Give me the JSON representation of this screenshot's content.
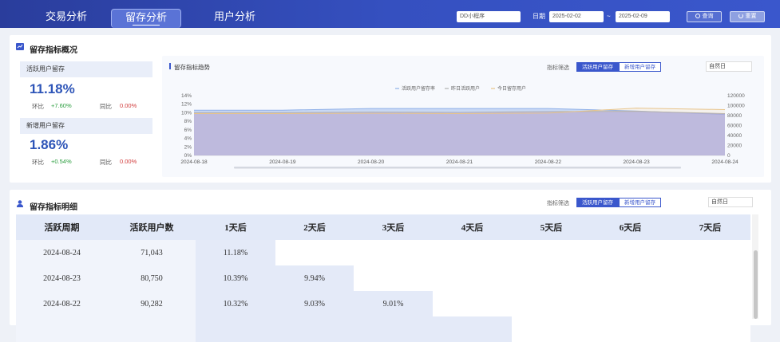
{
  "nav": {
    "tabs": [
      {
        "label": "交易分析"
      },
      {
        "label": "留存分析"
      },
      {
        "label": "用户分析"
      }
    ]
  },
  "filters": {
    "app": "DD小程序",
    "date_label": "日期",
    "start_date": "2025-02-02",
    "separator": "~",
    "end_date": "2025-02-09",
    "query_label": "查询",
    "reset_label": "重置"
  },
  "overview": {
    "title": "留存指标概况",
    "active": {
      "label": "活跃用户留存",
      "value": "11.18%",
      "mom_label": "环比",
      "mom_value": "+7.60%",
      "yoy_label": "同比",
      "yoy_value": "0.00%"
    },
    "new": {
      "label": "新增用户留存",
      "value": "1.86%",
      "mom_label": "环比",
      "mom_value": "+0.54%",
      "yoy_label": "同比",
      "yoy_value": "0.00%"
    }
  },
  "trend": {
    "title": "留存指标趋势",
    "filter_label": "指标筛选",
    "pill_active": "活跃用户留存",
    "pill_new": "新增用户留存",
    "period": "自然日"
  },
  "chart_data": {
    "type": "area",
    "x": [
      "2024-08-18",
      "2024-08-19",
      "2024-08-20",
      "2024-08-21",
      "2024-08-22",
      "2024-08-23",
      "2024-08-24"
    ],
    "series": [
      {
        "name": "活跃用户留存率",
        "axis": "left",
        "values": [
          10.6,
          10.6,
          11.0,
          11.0,
          11.0,
          10.4,
          9.6
        ],
        "color": "#8fb0e8"
      },
      {
        "name": "昨日活跃用户",
        "axis": "right",
        "values": [
          86000,
          86000,
          87000,
          86500,
          88000,
          88500,
          84000
        ],
        "color": "#b0b0b0"
      },
      {
        "name": "今日留存用户",
        "axis": "right",
        "values": [
          84000,
          84000,
          84500,
          84000,
          85000,
          95000,
          92000
        ],
        "color": "#e8c48a"
      }
    ],
    "y_left_ticks": [
      "14%",
      "12%",
      "10%",
      "8%",
      "6%",
      "4%",
      "2%",
      "0%"
    ],
    "y_right_ticks": [
      "120000",
      "100000",
      "80000",
      "60000",
      "40000",
      "20000",
      "0"
    ],
    "ylim_left": [
      0,
      14
    ],
    "ylim_right": [
      0,
      120000
    ],
    "grid": false,
    "legend": "top-center"
  },
  "detail": {
    "title": "留存指标明细",
    "filter_label": "指标筛选",
    "pill_active": "活跃用户留存",
    "pill_new": "新增用户留存",
    "period": "自然日",
    "headers": [
      "活跃周期",
      "活跃用户数",
      "1天后",
      "2天后",
      "3天后",
      "4天后",
      "5天后",
      "6天后",
      "7天后"
    ],
    "rows": [
      [
        "2024-08-24",
        "71,043",
        "11.18%",
        "",
        "",
        "",
        "",
        "",
        ""
      ],
      [
        "2024-08-23",
        "80,750",
        "10.39%",
        "9.94%",
        "",
        "",
        "",
        "",
        ""
      ],
      [
        "2024-08-22",
        "90,282",
        "10.32%",
        "9.03%",
        "9.01%",
        "",
        "",
        "",
        ""
      ],
      [
        "",
        "",
        "",
        "",
        "",
        "",
        "",
        "",
        ""
      ]
    ]
  },
  "colors": {
    "brand": "#3a57cc",
    "positive": "#2a9d3e",
    "negative": "#d13b3b"
  }
}
